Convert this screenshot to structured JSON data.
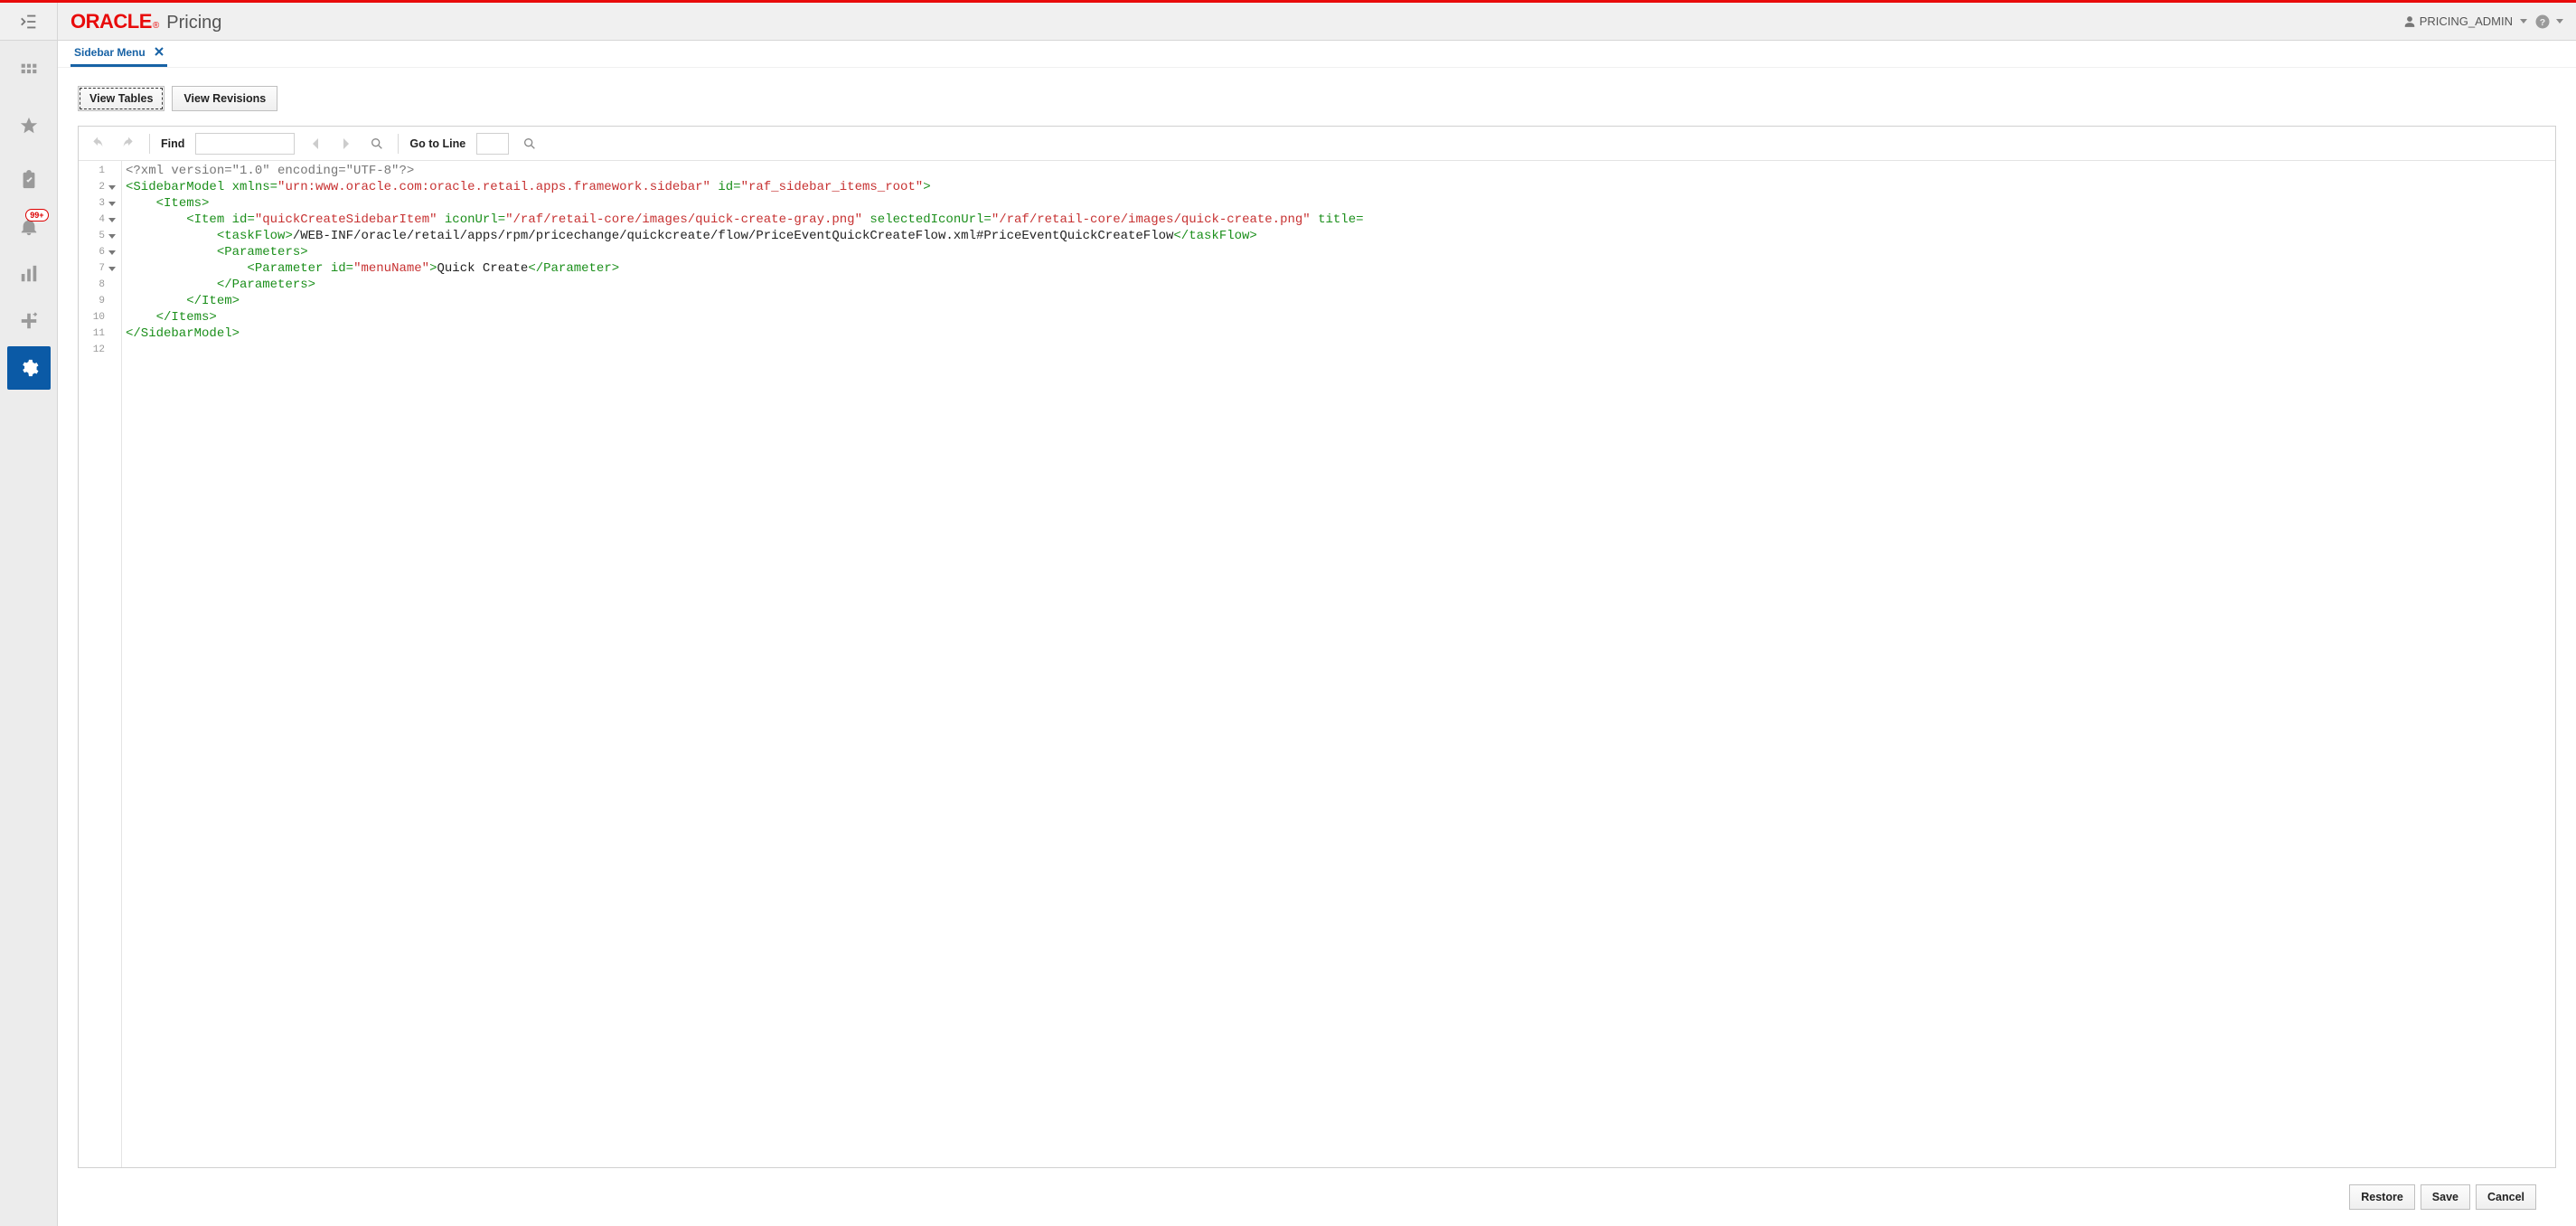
{
  "brand": {
    "oracle": "ORACLE",
    "reg": "®",
    "app": "Pricing"
  },
  "user": {
    "name": "PRICING_ADMIN"
  },
  "sidebar": {
    "notification_badge": "99+"
  },
  "tabs": [
    {
      "label": "Sidebar Menu"
    }
  ],
  "action_buttons": {
    "view_tables": "View Tables",
    "view_revisions": "View Revisions"
  },
  "editor_toolbar": {
    "find_label": "Find",
    "goto_label": "Go to Line"
  },
  "code": {
    "lines": [
      {
        "n": 1,
        "fold": false,
        "tokens": [
          {
            "c": "t-pi",
            "t": "<?xml version=\"1.0\" encoding=\"UTF-8\"?>"
          }
        ]
      },
      {
        "n": 2,
        "fold": true,
        "tokens": [
          {
            "c": "t-tag",
            "t": "<SidebarModel "
          },
          {
            "c": "t-attr",
            "t": "xmlns="
          },
          {
            "c": "t-val",
            "t": "\"urn:www.oracle.com:oracle.retail.apps.framework.sidebar\""
          },
          {
            "c": "t-tag",
            "t": " "
          },
          {
            "c": "t-attr",
            "t": "id="
          },
          {
            "c": "t-val",
            "t": "\"raf_sidebar_items_root\""
          },
          {
            "c": "t-tag",
            "t": ">"
          }
        ]
      },
      {
        "n": 3,
        "fold": true,
        "tokens": [
          {
            "c": "t-txt",
            "t": "    "
          },
          {
            "c": "t-tag",
            "t": "<Items>"
          }
        ]
      },
      {
        "n": 4,
        "fold": true,
        "tokens": [
          {
            "c": "t-txt",
            "t": "        "
          },
          {
            "c": "t-tag",
            "t": "<Item "
          },
          {
            "c": "t-attr",
            "t": "id="
          },
          {
            "c": "t-val",
            "t": "\"quickCreateSidebarItem\""
          },
          {
            "c": "t-tag",
            "t": " "
          },
          {
            "c": "t-attr",
            "t": "iconUrl="
          },
          {
            "c": "t-val",
            "t": "\"/raf/retail-core/images/quick-create-gray.png\""
          },
          {
            "c": "t-tag",
            "t": " "
          },
          {
            "c": "t-attr",
            "t": "selectedIconUrl="
          },
          {
            "c": "t-val",
            "t": "\"/raf/retail-core/images/quick-create.png\""
          },
          {
            "c": "t-tag",
            "t": " "
          },
          {
            "c": "t-attr",
            "t": "title="
          }
        ]
      },
      {
        "n": 5,
        "fold": true,
        "tokens": [
          {
            "c": "t-txt",
            "t": "            "
          },
          {
            "c": "t-tag",
            "t": "<taskFlow>"
          },
          {
            "c": "t-txt",
            "t": "/WEB-INF/oracle/retail/apps/rpm/pricechange/quickcreate/flow/PriceEventQuickCreateFlow.xml#PriceEventQuickCreateFlow"
          },
          {
            "c": "t-tag",
            "t": "</taskFlow>"
          }
        ]
      },
      {
        "n": 6,
        "fold": true,
        "tokens": [
          {
            "c": "t-txt",
            "t": "            "
          },
          {
            "c": "t-tag",
            "t": "<Parameters>"
          }
        ]
      },
      {
        "n": 7,
        "fold": true,
        "tokens": [
          {
            "c": "t-txt",
            "t": "                "
          },
          {
            "c": "t-tag",
            "t": "<Parameter "
          },
          {
            "c": "t-attr",
            "t": "id="
          },
          {
            "c": "t-val",
            "t": "\"menuName\""
          },
          {
            "c": "t-tag",
            "t": ">"
          },
          {
            "c": "t-txt",
            "t": "Quick Create"
          },
          {
            "c": "t-tag",
            "t": "</Parameter>"
          }
        ]
      },
      {
        "n": 8,
        "fold": false,
        "tokens": [
          {
            "c": "t-txt",
            "t": "            "
          },
          {
            "c": "t-tag",
            "t": "</Parameters>"
          }
        ]
      },
      {
        "n": 9,
        "fold": false,
        "tokens": [
          {
            "c": "t-txt",
            "t": "        "
          },
          {
            "c": "t-tag",
            "t": "</Item>"
          }
        ]
      },
      {
        "n": 10,
        "fold": false,
        "tokens": [
          {
            "c": "t-txt",
            "t": "    "
          },
          {
            "c": "t-tag",
            "t": "</Items>"
          }
        ]
      },
      {
        "n": 11,
        "fold": false,
        "tokens": [
          {
            "c": "t-tag",
            "t": "</SidebarModel>"
          }
        ]
      },
      {
        "n": 12,
        "fold": false,
        "tokens": [
          {
            "c": "t-txt",
            "t": ""
          }
        ]
      }
    ]
  },
  "footer": {
    "restore": "Restore",
    "save": "Save",
    "cancel": "Cancel"
  }
}
